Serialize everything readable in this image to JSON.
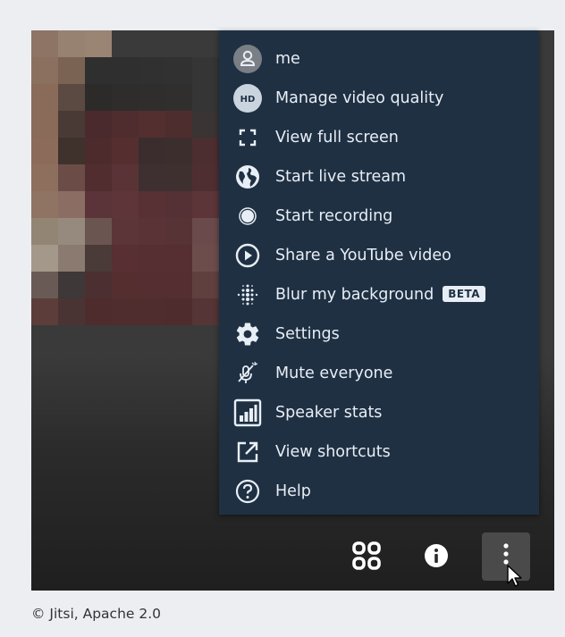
{
  "menu": {
    "items": [
      {
        "label": "me",
        "icon": "avatar-icon"
      },
      {
        "label": "Manage video quality",
        "icon": "hd-icon"
      },
      {
        "label": "View full screen",
        "icon": "fullscreen-icon"
      },
      {
        "label": "Start live stream",
        "icon": "globe-icon"
      },
      {
        "label": "Start recording",
        "icon": "record-icon"
      },
      {
        "label": "Share a YouTube video",
        "icon": "play-circle-icon"
      },
      {
        "label": "Blur my background",
        "icon": "blur-icon",
        "badge": "BETA"
      },
      {
        "label": "Settings",
        "icon": "gear-icon"
      },
      {
        "label": "Mute everyone",
        "icon": "mute-mic-icon"
      },
      {
        "label": "Speaker stats",
        "icon": "bar-chart-icon"
      },
      {
        "label": "View shortcuts",
        "icon": "external-link-icon"
      },
      {
        "label": "Help",
        "icon": "help-icon"
      }
    ]
  },
  "toolbar": {
    "tile_view_icon": "tile-view-icon",
    "info_icon": "info-icon",
    "more_icon": "more-vertical-icon"
  },
  "colors": {
    "menu_bg": "#1f3043",
    "menu_text": "#e8eef5",
    "hd_badge": "#c9d4df"
  },
  "footer": {
    "copyright": "© Jitsi, Apache 2.0"
  }
}
